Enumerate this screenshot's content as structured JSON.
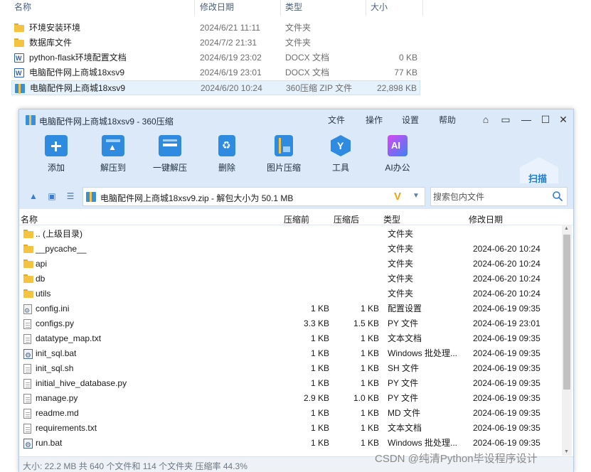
{
  "explorer": {
    "columns": [
      "名称",
      "修改日期",
      "类型",
      "大小"
    ],
    "rows": [
      {
        "name": "环境安装环境",
        "date": "2024/6/21 11:11",
        "type": "文件夹",
        "size": "",
        "icon": "folder-icon"
      },
      {
        "name": "数据库文件",
        "date": "2024/7/2 21:31",
        "type": "文件夹",
        "size": "",
        "icon": "folder-icon"
      },
      {
        "name": "python-flask环境配置文档",
        "date": "2024/6/19 23:02",
        "type": "DOCX 文档",
        "size": "0 KB",
        "icon": "word-doc-icon"
      },
      {
        "name": "电脑配件网上商城18xsv9",
        "date": "2024/6/19 23:01",
        "type": "DOCX 文档",
        "size": "77 KB",
        "icon": "word-doc-icon"
      },
      {
        "name": "电脑配件网上商城18xsv9",
        "date": "2024/6/20 10:24",
        "type": "360压缩 ZIP 文件",
        "size": "22,898 KB",
        "icon": "zip-archive-icon",
        "selected": true
      }
    ]
  },
  "window": {
    "title": "电脑配件网上商城18xsv9 - 360压缩",
    "menu": [
      "文件",
      "操作",
      "设置",
      "帮助"
    ],
    "toolbar": [
      {
        "label": "添加",
        "icon": "add-icon"
      },
      {
        "label": "解压到",
        "icon": "extract-to-icon"
      },
      {
        "label": "一键解压",
        "icon": "one-click-extract-icon"
      },
      {
        "label": "删除",
        "icon": "delete-icon"
      },
      {
        "label": "图片压缩",
        "icon": "image-compress-icon"
      },
      {
        "label": "工具",
        "icon": "tools-icon"
      },
      {
        "label": "AI办公",
        "icon": "ai-office-icon"
      }
    ],
    "scan_label": "扫描",
    "path": "电脑配件网上商城18xsv9.zip - 解包大小为 50.1 MB",
    "search_placeholder": "搜索包内文件",
    "columns": {
      "name": "名称",
      "csize": "压缩前",
      "osize": "压缩后",
      "type": "类型",
      "date": "修改日期"
    },
    "files": [
      {
        "name": ".. (上级目录)",
        "csize": "",
        "osize": "",
        "type": "文件夹",
        "date": "",
        "icon": "folder-icon"
      },
      {
        "name": "__pycache__",
        "csize": "",
        "osize": "",
        "type": "文件夹",
        "date": "2024-06-20 10:24",
        "icon": "folder-icon"
      },
      {
        "name": "api",
        "csize": "",
        "osize": "",
        "type": "文件夹",
        "date": "2024-06-20 10:24",
        "icon": "folder-icon"
      },
      {
        "name": "db",
        "csize": "",
        "osize": "",
        "type": "文件夹",
        "date": "2024-06-20 10:24",
        "icon": "folder-icon"
      },
      {
        "name": "utils",
        "csize": "",
        "osize": "",
        "type": "文件夹",
        "date": "2024-06-20 10:24",
        "icon": "folder-icon"
      },
      {
        "name": "config.ini",
        "csize": "1 KB",
        "osize": "1 KB",
        "type": "配置设置",
        "date": "2024-06-19 09:35",
        "icon": "config-file-icon"
      },
      {
        "name": "configs.py",
        "csize": "3.3 KB",
        "osize": "1.5 KB",
        "type": "PY 文件",
        "date": "2024-06-19 23:01",
        "icon": "file-icon"
      },
      {
        "name": "datatype_map.txt",
        "csize": "1 KB",
        "osize": "1 KB",
        "type": "文本文档",
        "date": "2024-06-19 09:35",
        "icon": "file-icon"
      },
      {
        "name": "init_sql.bat",
        "csize": "1 KB",
        "osize": "1 KB",
        "type": "Windows 批处理...",
        "date": "2024-06-19 09:35",
        "icon": "batch-file-icon"
      },
      {
        "name": "init_sql.sh",
        "csize": "1 KB",
        "osize": "1 KB",
        "type": "SH 文件",
        "date": "2024-06-19 09:35",
        "icon": "file-icon"
      },
      {
        "name": "initial_hive_database.py",
        "csize": "1 KB",
        "osize": "1 KB",
        "type": "PY 文件",
        "date": "2024-06-19 09:35",
        "icon": "file-icon"
      },
      {
        "name": "manage.py",
        "csize": "2.9 KB",
        "osize": "1.0 KB",
        "type": "PY 文件",
        "date": "2024-06-19 09:35",
        "icon": "file-icon"
      },
      {
        "name": "readme.md",
        "csize": "1 KB",
        "osize": "1 KB",
        "type": "MD 文件",
        "date": "2024-06-19 09:35",
        "icon": "file-icon"
      },
      {
        "name": "requirements.txt",
        "csize": "1 KB",
        "osize": "1 KB",
        "type": "文本文档",
        "date": "2024-06-19 09:35",
        "icon": "file-icon"
      },
      {
        "name": "run.bat",
        "csize": "1 KB",
        "osize": "1 KB",
        "type": "Windows 批处理...",
        "date": "2024-06-19 09:35",
        "icon": "batch-file-icon"
      }
    ],
    "status": "大小: 22.2 MB 共 640 个文件和 114 个文件夹 压缩率 44.3%"
  },
  "watermark": "CSDN @纯清Python毕设程序设计"
}
